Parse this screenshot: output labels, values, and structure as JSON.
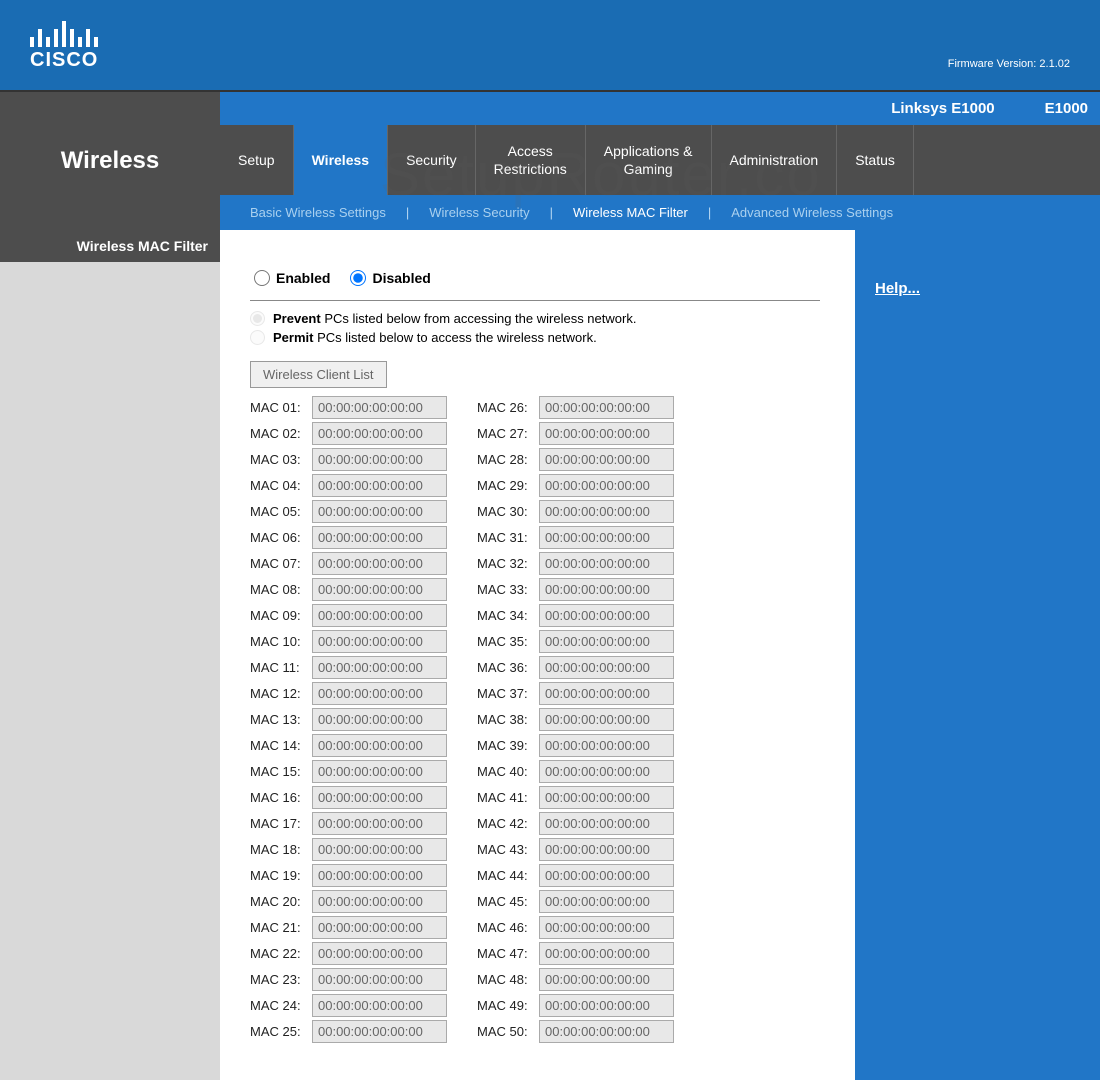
{
  "brand": {
    "name": "CISCO"
  },
  "header": {
    "firmware_label": "Firmware Version: 2.1.02",
    "model_name": "Linksys E1000",
    "model_code": "E1000"
  },
  "page_title": "Wireless",
  "main_tabs": [
    {
      "label": "Setup",
      "active": false
    },
    {
      "label": "Wireless",
      "active": true
    },
    {
      "label": "Security",
      "active": false
    },
    {
      "label": "Access\nRestrictions",
      "active": false
    },
    {
      "label": "Applications &\nGaming",
      "active": false
    },
    {
      "label": "Administration",
      "active": false
    },
    {
      "label": "Status",
      "active": false
    }
  ],
  "sub_tabs": [
    {
      "label": "Basic Wireless Settings",
      "active": false
    },
    {
      "label": "Wireless Security",
      "active": false
    },
    {
      "label": "Wireless MAC Filter",
      "active": true
    },
    {
      "label": "Advanced Wireless Settings",
      "active": false
    }
  ],
  "sidebar": {
    "section_label": "Wireless MAC Filter"
  },
  "filter": {
    "enabled_label": "Enabled",
    "disabled_label": "Disabled",
    "state": "disabled",
    "policy_prevent_bold": "Prevent",
    "policy_prevent_text": " PCs listed below from accessing the wireless network.",
    "policy_permit_bold": "Permit",
    "policy_permit_text": " PCs listed below to access the wireless network.",
    "policy_state": "prevent",
    "client_list_btn": "Wireless Client List"
  },
  "mac_entries_col1": [
    {
      "label": "MAC 01:",
      "value": "00:00:00:00:00:00"
    },
    {
      "label": "MAC 02:",
      "value": "00:00:00:00:00:00"
    },
    {
      "label": "MAC 03:",
      "value": "00:00:00:00:00:00"
    },
    {
      "label": "MAC 04:",
      "value": "00:00:00:00:00:00"
    },
    {
      "label": "MAC 05:",
      "value": "00:00:00:00:00:00"
    },
    {
      "label": "MAC 06:",
      "value": "00:00:00:00:00:00"
    },
    {
      "label": "MAC 07:",
      "value": "00:00:00:00:00:00"
    },
    {
      "label": "MAC 08:",
      "value": "00:00:00:00:00:00"
    },
    {
      "label": "MAC 09:",
      "value": "00:00:00:00:00:00"
    },
    {
      "label": "MAC 10:",
      "value": "00:00:00:00:00:00"
    },
    {
      "label": "MAC 11:",
      "value": "00:00:00:00:00:00"
    },
    {
      "label": "MAC 12:",
      "value": "00:00:00:00:00:00"
    },
    {
      "label": "MAC 13:",
      "value": "00:00:00:00:00:00"
    },
    {
      "label": "MAC 14:",
      "value": "00:00:00:00:00:00"
    },
    {
      "label": "MAC 15:",
      "value": "00:00:00:00:00:00"
    },
    {
      "label": "MAC 16:",
      "value": "00:00:00:00:00:00"
    },
    {
      "label": "MAC 17:",
      "value": "00:00:00:00:00:00"
    },
    {
      "label": "MAC 18:",
      "value": "00:00:00:00:00:00"
    },
    {
      "label": "MAC 19:",
      "value": "00:00:00:00:00:00"
    },
    {
      "label": "MAC 20:",
      "value": "00:00:00:00:00:00"
    },
    {
      "label": "MAC 21:",
      "value": "00:00:00:00:00:00"
    },
    {
      "label": "MAC 22:",
      "value": "00:00:00:00:00:00"
    },
    {
      "label": "MAC 23:",
      "value": "00:00:00:00:00:00"
    },
    {
      "label": "MAC 24:",
      "value": "00:00:00:00:00:00"
    },
    {
      "label": "MAC 25:",
      "value": "00:00:00:00:00:00"
    }
  ],
  "mac_entries_col2": [
    {
      "label": "MAC 26:",
      "value": "00:00:00:00:00:00"
    },
    {
      "label": "MAC 27:",
      "value": "00:00:00:00:00:00"
    },
    {
      "label": "MAC 28:",
      "value": "00:00:00:00:00:00"
    },
    {
      "label": "MAC 29:",
      "value": "00:00:00:00:00:00"
    },
    {
      "label": "MAC 30:",
      "value": "00:00:00:00:00:00"
    },
    {
      "label": "MAC 31:",
      "value": "00:00:00:00:00:00"
    },
    {
      "label": "MAC 32:",
      "value": "00:00:00:00:00:00"
    },
    {
      "label": "MAC 33:",
      "value": "00:00:00:00:00:00"
    },
    {
      "label": "MAC 34:",
      "value": "00:00:00:00:00:00"
    },
    {
      "label": "MAC 35:",
      "value": "00:00:00:00:00:00"
    },
    {
      "label": "MAC 36:",
      "value": "00:00:00:00:00:00"
    },
    {
      "label": "MAC 37:",
      "value": "00:00:00:00:00:00"
    },
    {
      "label": "MAC 38:",
      "value": "00:00:00:00:00:00"
    },
    {
      "label": "MAC 39:",
      "value": "00:00:00:00:00:00"
    },
    {
      "label": "MAC 40:",
      "value": "00:00:00:00:00:00"
    },
    {
      "label": "MAC 41:",
      "value": "00:00:00:00:00:00"
    },
    {
      "label": "MAC 42:",
      "value": "00:00:00:00:00:00"
    },
    {
      "label": "MAC 43:",
      "value": "00:00:00:00:00:00"
    },
    {
      "label": "MAC 44:",
      "value": "00:00:00:00:00:00"
    },
    {
      "label": "MAC 45:",
      "value": "00:00:00:00:00:00"
    },
    {
      "label": "MAC 46:",
      "value": "00:00:00:00:00:00"
    },
    {
      "label": "MAC 47:",
      "value": "00:00:00:00:00:00"
    },
    {
      "label": "MAC 48:",
      "value": "00:00:00:00:00:00"
    },
    {
      "label": "MAC 49:",
      "value": "00:00:00:00:00:00"
    },
    {
      "label": "MAC 50:",
      "value": "00:00:00:00:00:00"
    }
  ],
  "help": {
    "label": "Help..."
  },
  "watermark": "SetupRouter.co"
}
